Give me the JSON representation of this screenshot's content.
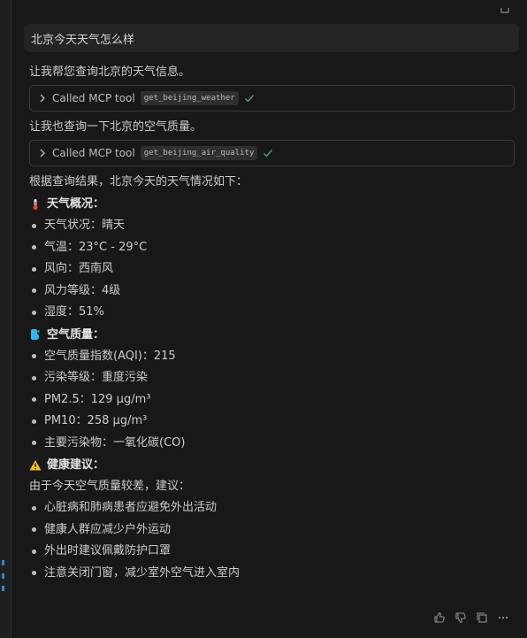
{
  "user_message": "北京今天天气怎么样",
  "intro_1": "让我帮您查询北京的天气信息。",
  "tool_1": {
    "label": "Called MCP tool",
    "name": "get_beijing_weather"
  },
  "intro_2": "让我也查询一下北京的空气质量。",
  "tool_2": {
    "label": "Called MCP tool",
    "name": "get_beijing_air_quality"
  },
  "summary": "根据查询结果，北京今天的天气情况如下：",
  "weather": {
    "heading": "天气概况：",
    "items": [
      "天气状况：晴天",
      "气温：23°C - 29°C",
      "风向：西南风",
      "风力等级：4级",
      "湿度：51%"
    ]
  },
  "air": {
    "heading": "空气质量：",
    "items": [
      "空气质量指数(AQI)：215",
      "污染等级：重度污染",
      "PM2.5：129 μg/m³",
      "PM10：258 μg/m³",
      "主要污染物：一氧化碳(CO)"
    ]
  },
  "health": {
    "heading": "健康建议：",
    "intro": "由于今天空气质量较差，建议：",
    "items": [
      "心脏病和肺病患者应避免外出活动",
      "健康人群应减少户外运动",
      "外出时建议佩戴防护口罩",
      "注意关闭门窗，减少室外空气进入室内"
    ]
  },
  "icons": [
    "copy-icon",
    "thermometer-icon",
    "droplet-icon",
    "warning-icon",
    "thumbs-up-icon",
    "thumbs-down-icon",
    "copy-icon",
    "more-icon"
  ],
  "colors": {
    "background": "#181818",
    "check": "#4ea27c",
    "warning": "#f5c518",
    "droplet": "#35b6ea"
  }
}
